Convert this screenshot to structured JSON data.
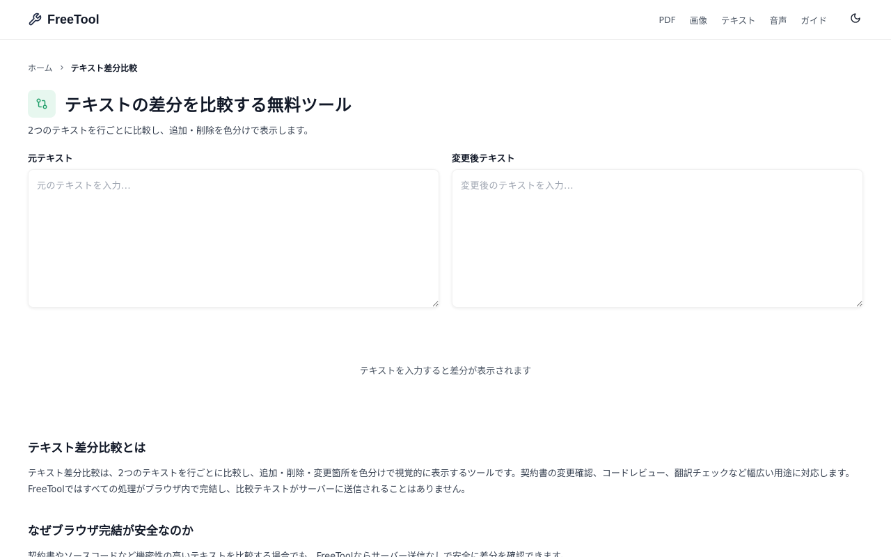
{
  "header": {
    "brand": "FreeTool",
    "nav": [
      "PDF",
      "画像",
      "テキスト",
      "音声",
      "ガイド"
    ],
    "theme_icon": "moon-icon"
  },
  "breadcrumb": {
    "home": "ホーム",
    "current": "テキスト差分比較"
  },
  "page": {
    "title": "テキストの差分を比較する無料ツール",
    "description": "2つのテキストを行ごとに比較し、追加・削除を色分けで表示します。",
    "icon": "git-compare-icon",
    "accent": "#22a06b"
  },
  "editors": {
    "original_label": "元テキスト",
    "original_placeholder": "元のテキストを入力...",
    "original_value": "",
    "modified_label": "変更後テキスト",
    "modified_placeholder": "変更後のテキストを入力...",
    "modified_value": ""
  },
  "result": {
    "empty_message": "テキストを入力すると差分が表示されます"
  },
  "sections": [
    {
      "title": "テキスト差分比較とは",
      "body": "テキスト差分比較は、2つのテキストを行ごとに比較し、追加・削除・変更箇所を色分けで視覚的に表示するツールです。契約書の変更確認、コードレビュー、翻訳チェックなど幅広い用途に対応します。FreeToolではすべての処理がブラウザ内で完結し、比較テキストがサーバーに送信されることはありません。"
    },
    {
      "title": "なぜブラウザ完結が安全なのか",
      "body": "契約書やソースコードなど機密性の高いテキストを比較する場合でも、FreeToolならサーバー送信なしで安全に差分を確認できます。"
    }
  ]
}
